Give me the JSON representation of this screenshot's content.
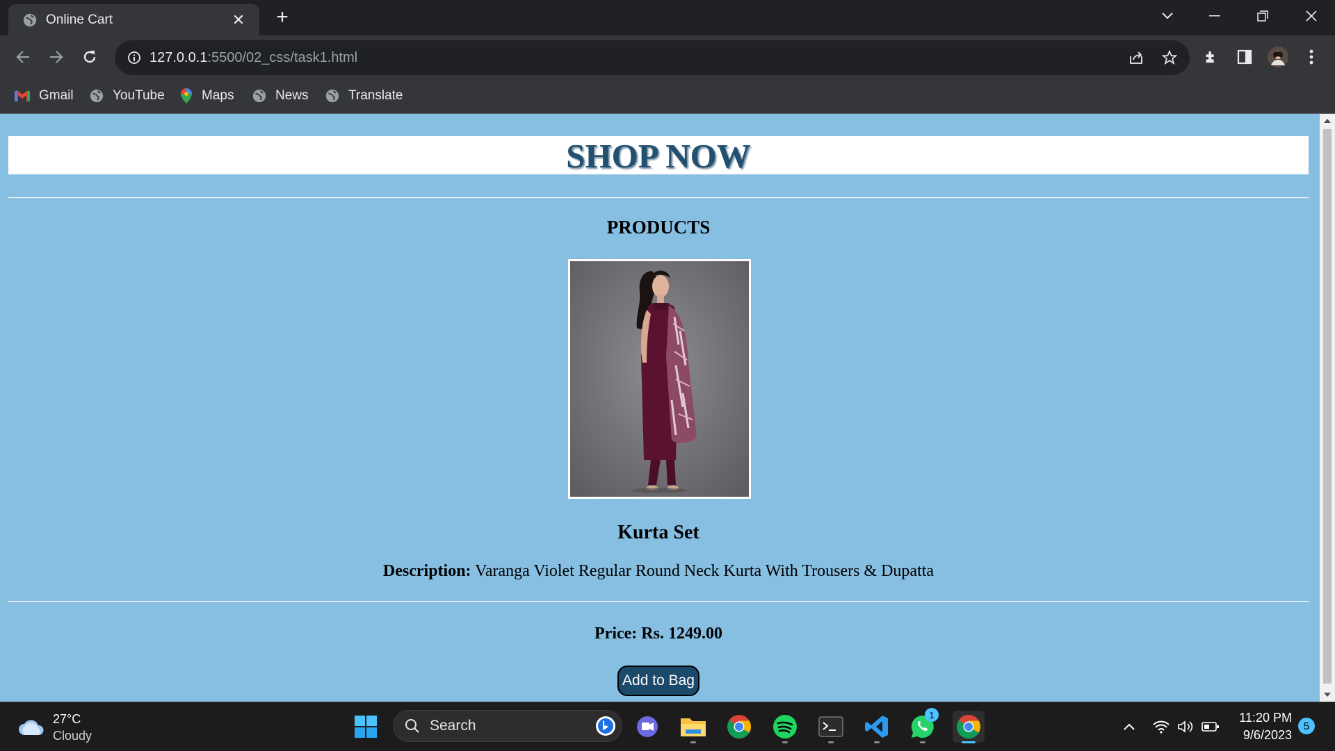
{
  "browser": {
    "tab_title": "Online Cart",
    "url_host": "127.0.0.1",
    "url_rest": ":5500/02_css/task1.html",
    "bookmarks": [
      {
        "label": "Gmail",
        "icon": "gmail-icon"
      },
      {
        "label": "YouTube",
        "icon": "globe-icon"
      },
      {
        "label": "Maps",
        "icon": "maps-icon"
      },
      {
        "label": "News",
        "icon": "globe-icon"
      },
      {
        "label": "Translate",
        "icon": "globe-icon"
      }
    ]
  },
  "page": {
    "header": "SHOP NOW",
    "section_title": "PRODUCTS",
    "product": {
      "name": "Kurta Set",
      "description_label": "Description:",
      "description": "Varanga Violet Regular Round Neck Kurta With Trousers & Dupatta",
      "price": "Price: Rs. 1249.00",
      "button": "Add to Bag"
    },
    "colors": {
      "background": "#87bfe3",
      "header_text": "#23506f",
      "button_bg": "#1c4a6b"
    }
  },
  "taskbar": {
    "weather_temp": "27°C",
    "weather_cond": "Cloudy",
    "search_placeholder": "Search",
    "whatsapp_badge": "1",
    "time": "11:20 PM",
    "date": "9/6/2023",
    "notification_count": "5"
  }
}
